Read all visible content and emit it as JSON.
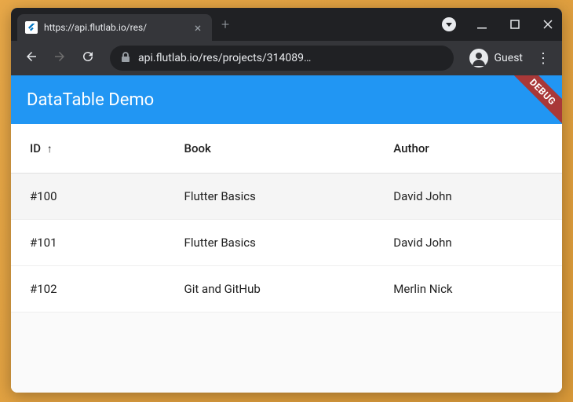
{
  "browser": {
    "tab_title": "https://api.flutlab.io/res/",
    "url": "api.flutlab.io/res/projects/314089…",
    "guest_label": "Guest"
  },
  "app": {
    "title": "DataTable Demo",
    "debug_label": "DEBUG"
  },
  "table": {
    "columns": {
      "id": "ID",
      "book": "Book",
      "author": "Author"
    },
    "rows": [
      {
        "id": "#100",
        "book": "Flutter Basics",
        "author": "David John",
        "selected": true
      },
      {
        "id": "#101",
        "book": "Flutter Basics",
        "author": "David John",
        "selected": false
      },
      {
        "id": "#102",
        "book": "Git and GitHub",
        "author": "Merlin Nick",
        "selected": false
      }
    ]
  }
}
